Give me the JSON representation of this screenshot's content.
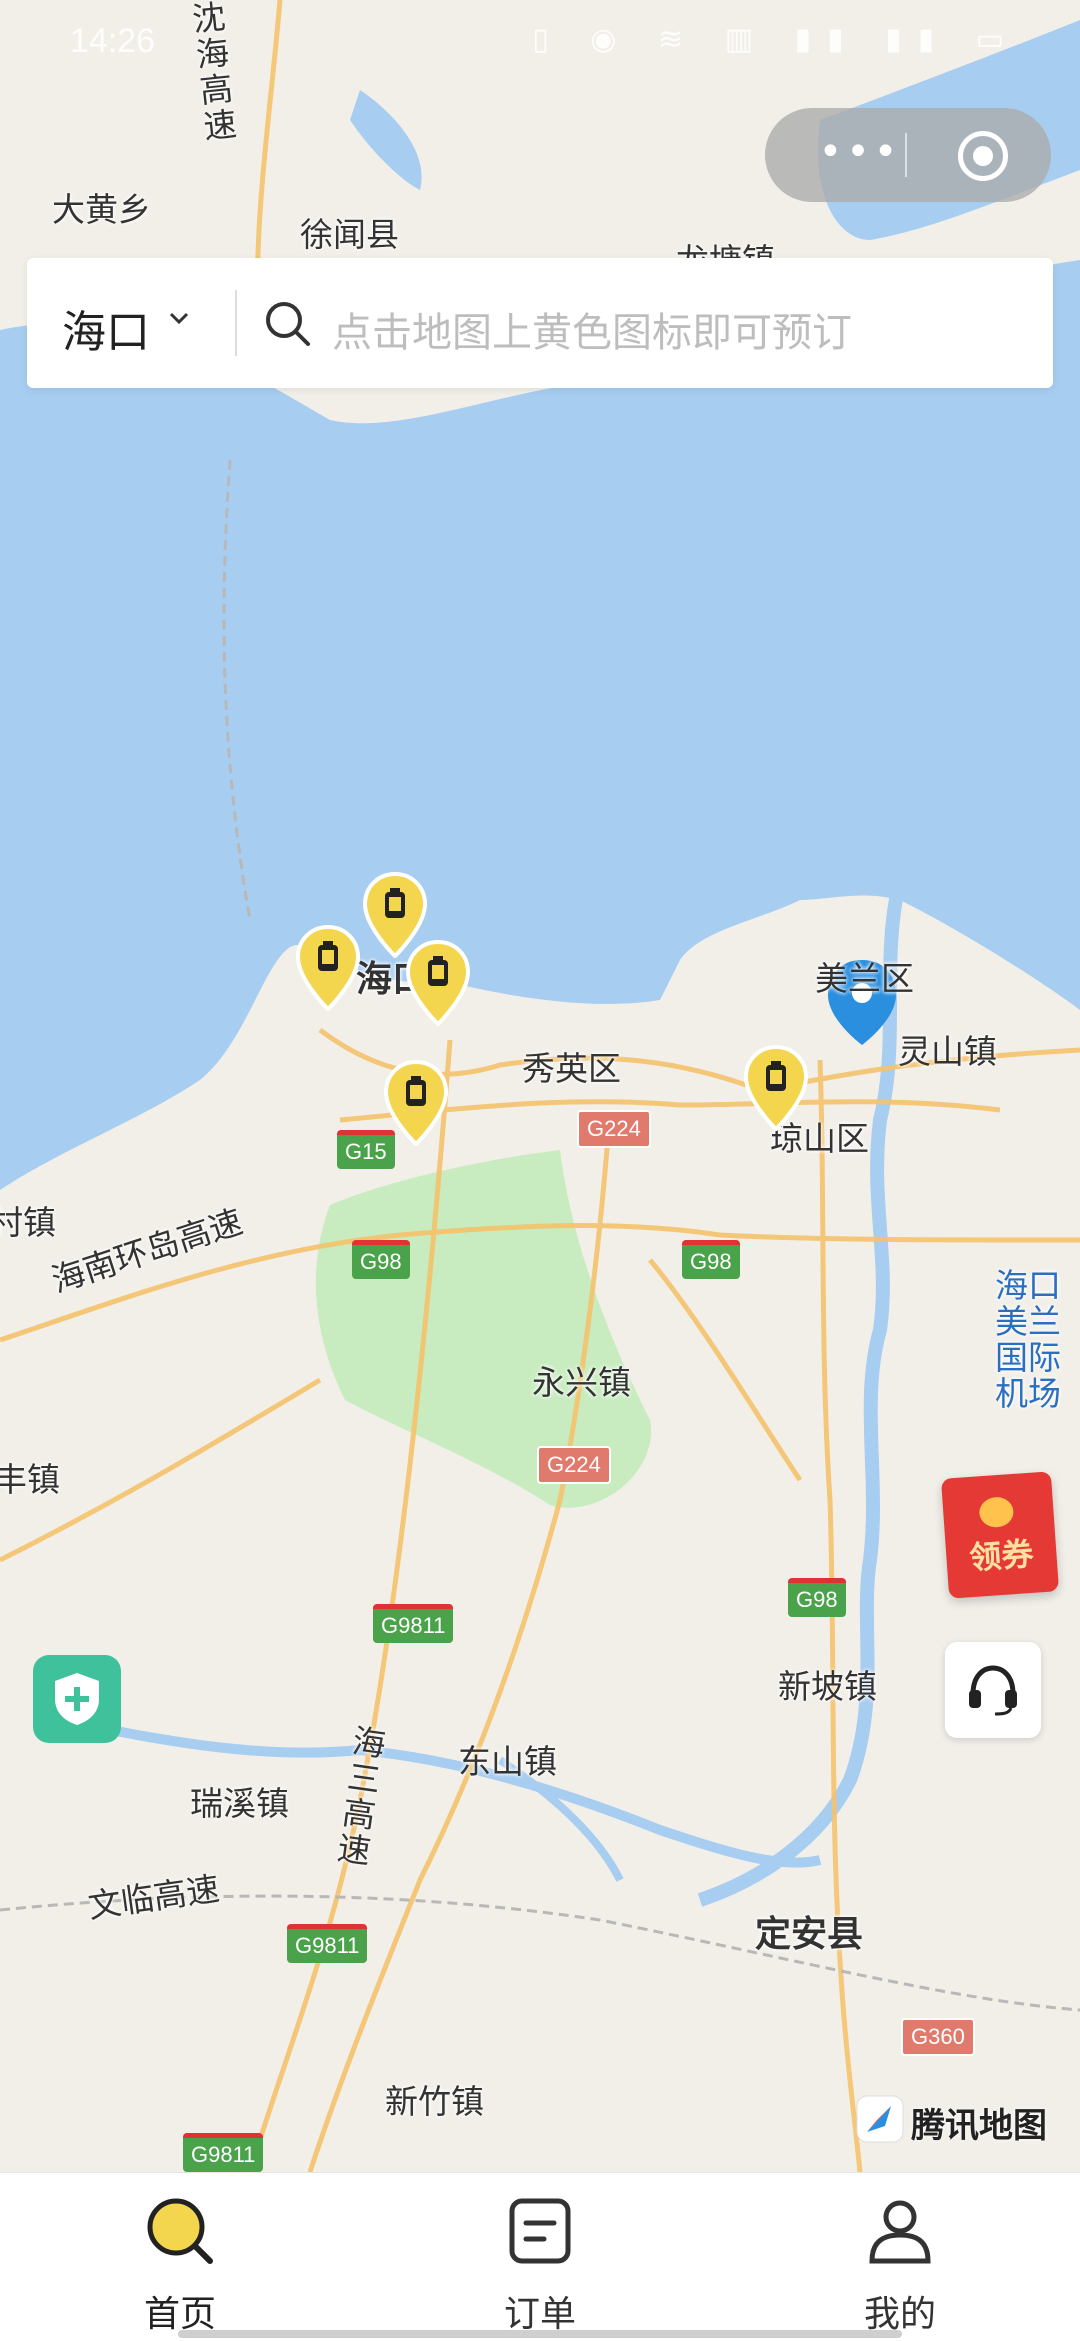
{
  "status_bar": {
    "time": "14:26"
  },
  "capsule": {
    "more_icon": "more-dots-icon",
    "target_icon": "target-icon"
  },
  "search": {
    "city": "海口",
    "placeholder": "点击地图上黄色图标即可预订"
  },
  "map": {
    "labels": {
      "dahuang": "大黄乡",
      "xuwen": "徐闻县",
      "longtang": "龙塘镇",
      "haikou": "海口市",
      "meilan": "美兰区",
      "lingshan": "灵山镇",
      "xiuying": "秀英区",
      "qiongshan": "琼山区",
      "cun": "村镇",
      "huandao": "海南环岛高速",
      "yongxing": "永兴镇",
      "feng": "丰镇",
      "xinpo": "新坡镇",
      "dongshan": "东山镇",
      "ruixi": "瑞溪镇",
      "wenlin": "文临高速",
      "dingan": "定安县",
      "xinzhu": "新竹镇",
      "airport": "海口美兰国际机场",
      "haisan": "海三高速",
      "shanghai_hw": "沈海高速"
    },
    "highways": {
      "g15": "G15",
      "g98a": "G98",
      "g98b": "G98",
      "g98c": "G98",
      "g224a": "G224",
      "g224b": "G224",
      "g9811a": "G9811",
      "g9811b": "G9811",
      "g9811c": "G9811",
      "g360": "G360"
    },
    "watermark": "腾讯地图"
  },
  "floating": {
    "coupon": "领券"
  },
  "tabs": [
    {
      "label": "首页",
      "icon": "home-search-icon"
    },
    {
      "label": "订单",
      "icon": "order-icon"
    },
    {
      "label": "我的",
      "icon": "profile-icon"
    }
  ],
  "colors": {
    "sea": "#a7cdf1",
    "land": "#f2efe9",
    "accent": "#f3d54e",
    "location": "#2b8fe0"
  }
}
